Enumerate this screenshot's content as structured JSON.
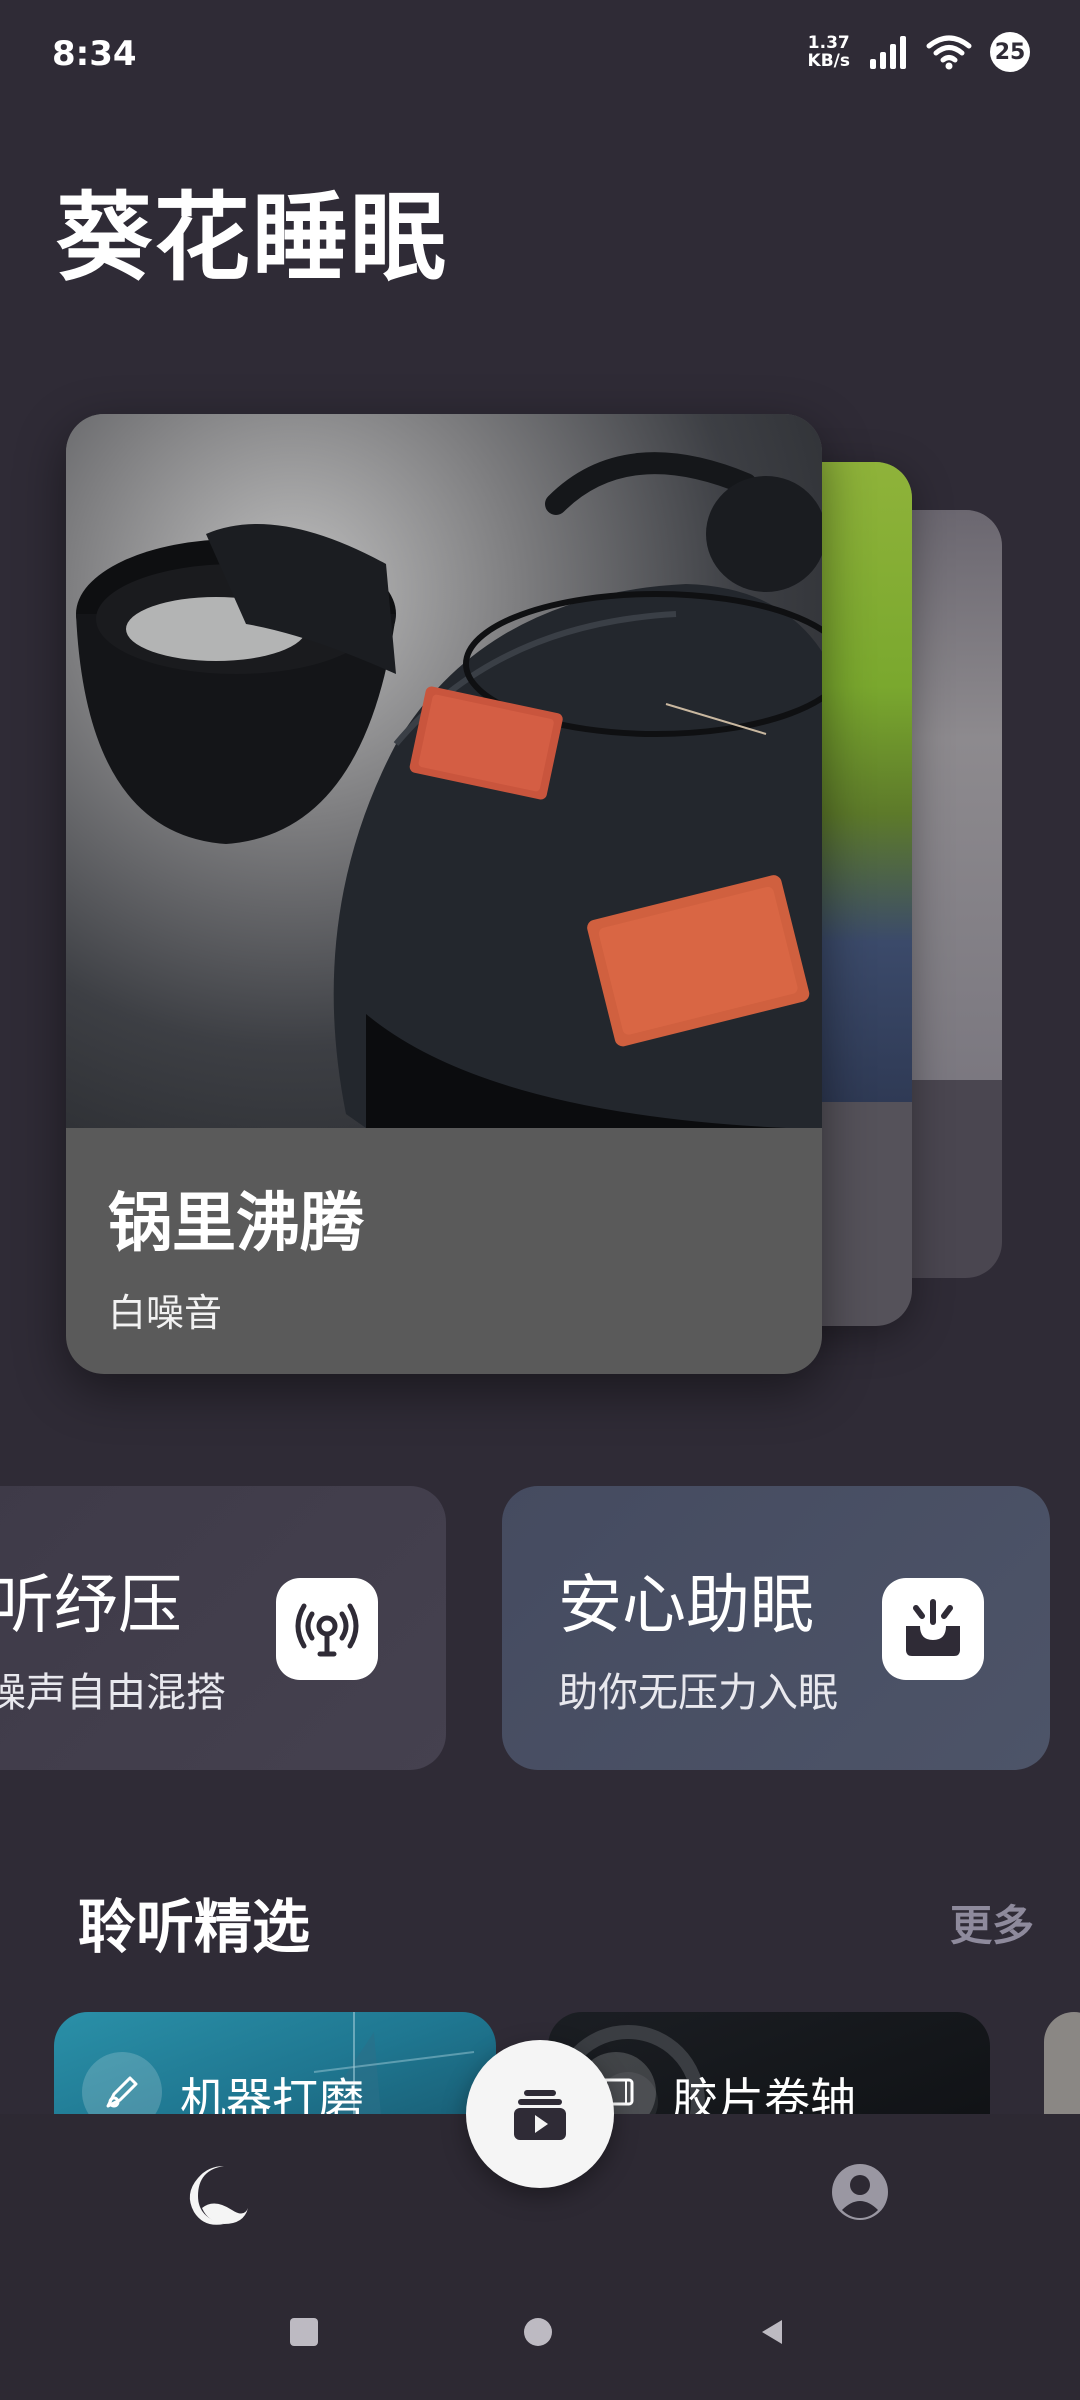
{
  "status": {
    "time": "8:34",
    "net_speed_value": "1.37",
    "net_speed_unit": "KB/s",
    "battery": "25"
  },
  "app": {
    "title": "葵花睡眠"
  },
  "carousel": {
    "main": {
      "title": "锅里沸腾",
      "subtitle": "白噪音"
    }
  },
  "features": [
    {
      "title": "聆听纾压",
      "subtitle": "白噪声自由混搭",
      "icon": "broadcast-icon"
    },
    {
      "title": "安心助眠",
      "subtitle": "助你无压力入眠",
      "icon": "sunrise-alarm-icon"
    }
  ],
  "section": {
    "title": "聆听精选",
    "more": "更多"
  },
  "chips": [
    {
      "label": "机器打磨",
      "icon": "pencil-tool-icon"
    },
    {
      "label": "胶片卷轴",
      "icon": "film-icon"
    }
  ],
  "nav": {
    "items": [
      "home-moon-icon",
      "play-library-icon",
      "profile-icon"
    ]
  },
  "colors": {
    "background": "#2f2b36",
    "accent_muted": "#8e8a9c",
    "card": "#5a5a5a"
  }
}
